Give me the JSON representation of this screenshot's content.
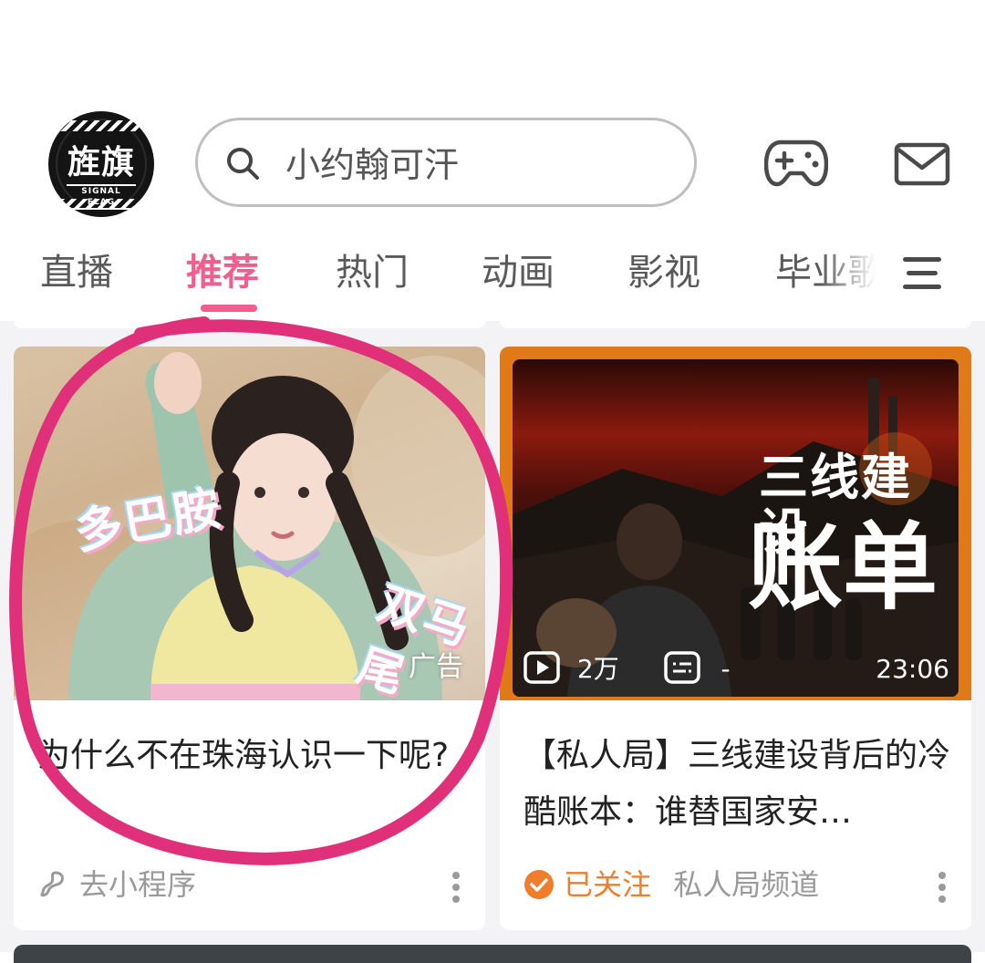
{
  "header": {
    "logo": {
      "text_cn": "旌旗",
      "text_en": "SIGNAL FLAG"
    },
    "search": {
      "placeholder": "小约翰可汗"
    },
    "icons": {
      "game": "gamepad-icon",
      "message": "mail-icon"
    }
  },
  "tabs": [
    {
      "label": "直播",
      "active": false
    },
    {
      "label": "推荐",
      "active": true
    },
    {
      "label": "热门",
      "active": false
    },
    {
      "label": "动画",
      "active": false
    },
    {
      "label": "影视",
      "active": false
    },
    {
      "label": "毕业歌",
      "active": false
    }
  ],
  "colors": {
    "accent": "#f25d8e",
    "follow": "#f07d2c",
    "feed_bg": "#f3f3f5"
  },
  "feed": {
    "cards": [
      {
        "type": "ad",
        "overlay_texts": [
          "多巴胺",
          "双马尾"
        ],
        "badge": "广告",
        "title": "为什么不在珠海认识一下呢?",
        "meta": {
          "icon": "mini-program-icon",
          "label": "去小程序"
        }
      },
      {
        "type": "video",
        "overlay_line1": "三线建设",
        "overlay_line2": "账单",
        "stats": {
          "views": "2万",
          "danmaku": "-"
        },
        "duration": "23:06",
        "title": "【私人局】三线建设背后的冷酷账本：谁替国家安…",
        "meta": {
          "followed": "已关注",
          "channel": "私人局频道"
        }
      }
    ]
  },
  "annotation": {
    "color": "#e0307a"
  }
}
